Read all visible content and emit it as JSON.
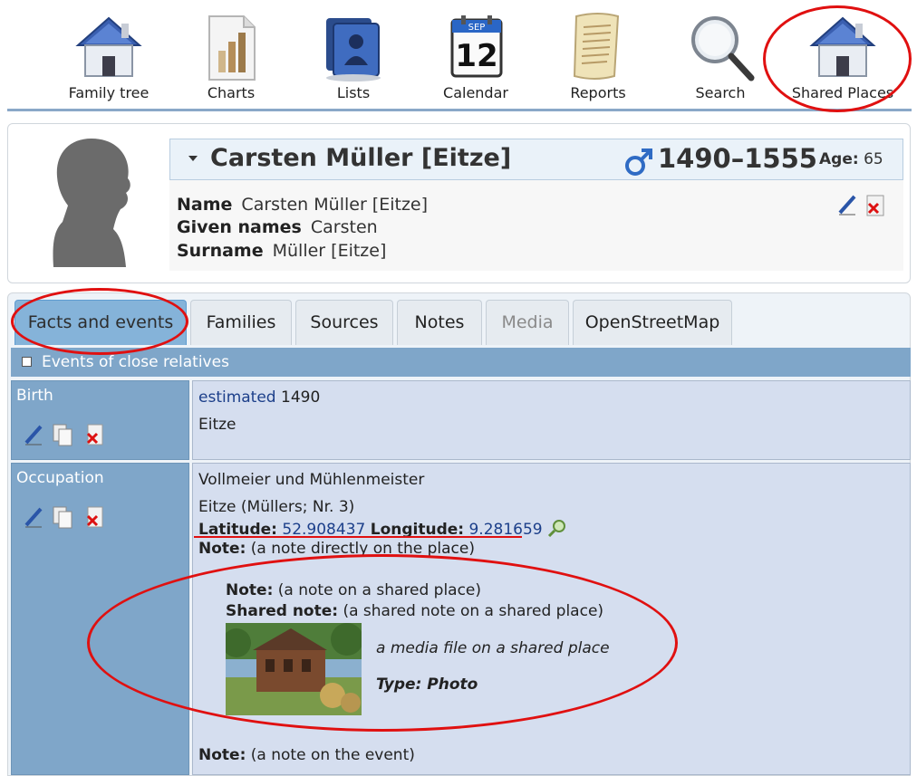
{
  "top_menu": [
    {
      "label": "Family tree",
      "icon": "house-icon"
    },
    {
      "label": "Charts",
      "icon": "chart-icon"
    },
    {
      "label": "Lists",
      "icon": "lists-icon"
    },
    {
      "label": "Calendar",
      "icon": "calendar-icon",
      "calendar_month": "SEP",
      "calendar_day": "12"
    },
    {
      "label": "Reports",
      "icon": "scroll-icon"
    },
    {
      "label": "Search",
      "icon": "magnifier-icon"
    },
    {
      "label": "Shared Places",
      "icon": "house-icon"
    }
  ],
  "individual": {
    "full_name": "Carsten Müller [Eitze]",
    "sex_icon": "male-icon",
    "life_span": "1490–1555",
    "age_label": "Age:",
    "age_value": "65",
    "name_rows": [
      {
        "label": "Name",
        "value": "Carsten Müller [Eitze]"
      },
      {
        "label": "Given names",
        "value": "Carsten"
      },
      {
        "label": "Surname",
        "value": "Müller [Eitze]"
      }
    ]
  },
  "tabs": [
    {
      "label": "Facts and events",
      "state": "active"
    },
    {
      "label": "Families",
      "state": "normal"
    },
    {
      "label": "Sources",
      "state": "normal"
    },
    {
      "label": "Notes",
      "state": "normal"
    },
    {
      "label": "Media",
      "state": "disabled"
    },
    {
      "label": "OpenStreetMap",
      "state": "normal"
    }
  ],
  "relatives_toggle": {
    "label": "Events of close relatives",
    "checked": false
  },
  "facts": {
    "birth": {
      "label": "Birth",
      "date_qualifier": "estimated",
      "date": "1490",
      "place": "Eitze"
    },
    "occupation": {
      "label": "Occupation",
      "value": "Vollmeier und Mühlenmeister",
      "place": "Eitze (Müllers; Nr. 3)",
      "latitude_label": "Latitude:",
      "latitude": "52.908437",
      "longitude_label": "Longitude:",
      "longitude": "9.281659",
      "note_label": "Note:",
      "place_note": "(a note directly on the place)",
      "shared_place_note": "(a note on a shared place)",
      "shared_note_label": "Shared note:",
      "shared_note": "(a shared note on a shared place)",
      "media_caption": "a media file on a shared place",
      "media_type": "Type: Photo",
      "event_note": "(a note on the event)"
    }
  },
  "colors": {
    "accent_blue": "#7fa6c9",
    "value_bg": "#d5deef",
    "annotation_red": "#e01010",
    "link_blue": "#1c3f8a"
  }
}
